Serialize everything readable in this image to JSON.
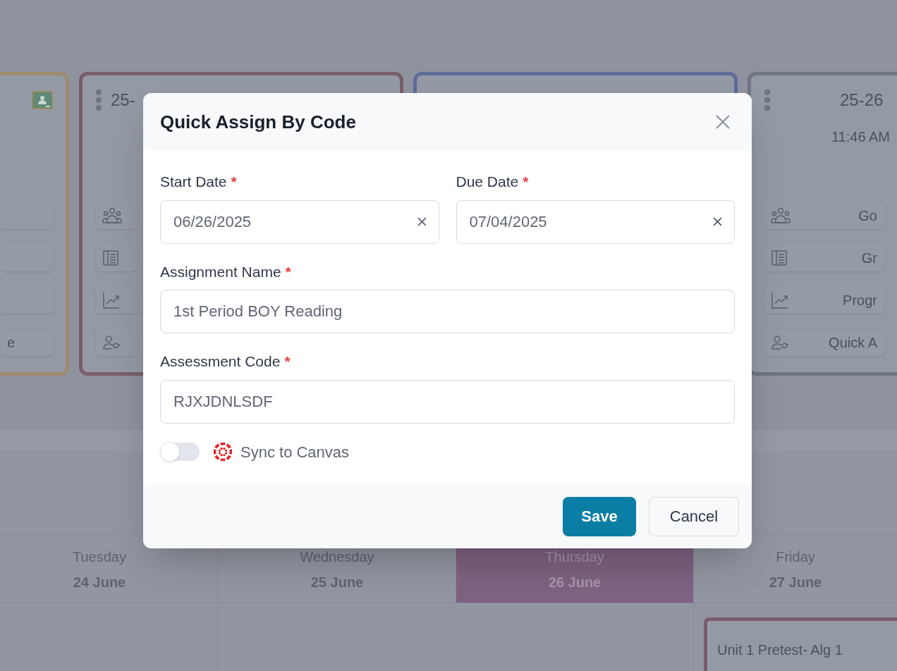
{
  "cards": [
    {
      "color": "#a08a6e",
      "kind": "badge",
      "rows": [
        {
          "kind": "plain"
        },
        {
          "kind": "plain"
        },
        {
          "kind": "plain"
        },
        {
          "kind": "plain",
          "label": "e"
        }
      ]
    },
    {
      "color": "#7a5d6c",
      "kind": "menu",
      "title": "25-",
      "rows": [
        {
          "kind": "icon"
        },
        {
          "kind": "icon"
        },
        {
          "kind": "icon"
        },
        {
          "kind": "icon"
        }
      ]
    },
    {
      "color": "#5d6b98",
      "kind": "plain"
    },
    {
      "color": "#6f7582",
      "kind": "menu",
      "title": "25-26",
      "time": "11:46 AM",
      "rows": [
        {
          "kind": "icon",
          "label": "Go"
        },
        {
          "kind": "icon",
          "label": "Gr"
        },
        {
          "kind": "icon",
          "label": "Progr"
        },
        {
          "kind": "icon",
          "label": "Quick A"
        }
      ]
    }
  ],
  "calendar": {
    "days": [
      {
        "weekday": "Tuesday",
        "date": "24 June",
        "selected": false
      },
      {
        "weekday": "Wednesday",
        "date": "25 June",
        "selected": false
      },
      {
        "weekday": "Thursday",
        "date": "26 June",
        "selected": true
      },
      {
        "weekday": "Friday",
        "date": "27 June",
        "selected": false,
        "events": [
          {
            "title": "Unit 1 Pretest- Alg 1",
            "color": "#7a5d6c"
          }
        ]
      }
    ]
  },
  "modal": {
    "title": "Quick Assign By Code",
    "fields": [
      {
        "kind": "date",
        "label": "Start Date",
        "required_mark": "*",
        "value": "06/26/2025"
      },
      {
        "kind": "date",
        "label": "Due Date",
        "required_mark": "*",
        "value": "07/04/2025"
      },
      {
        "kind": "text",
        "label": "Assignment Name",
        "required_mark": "*",
        "value": "1st Period BOY Reading"
      },
      {
        "kind": "text",
        "label": "Assessment Code",
        "required_mark": "*",
        "value": "RJXJDNLSDF"
      }
    ],
    "toggle": {
      "label": "Sync to Canvas",
      "on": false
    },
    "buttons": [
      {
        "label": "Save",
        "kind": "primary"
      },
      {
        "label": "Cancel",
        "kind": "secondary"
      }
    ]
  }
}
